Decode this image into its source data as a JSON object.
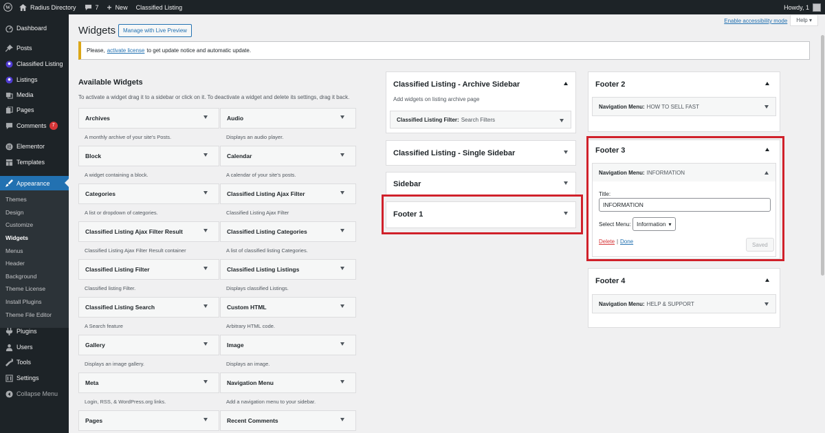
{
  "admin_bar": {
    "site_name": "Radius Directory",
    "comments_count": "7",
    "new_label": "New",
    "classified_label": "Classified Listing",
    "howdy": "Howdy, 1"
  },
  "sidebar": {
    "items": [
      {
        "label": "Dashboard",
        "icon": "dashboard-icon"
      },
      {
        "label": "Posts",
        "icon": "pin-icon"
      },
      {
        "label": "Classified Listing",
        "icon": "classified-icon"
      },
      {
        "label": "Listings",
        "icon": "listings-icon"
      },
      {
        "label": "Media",
        "icon": "media-icon"
      },
      {
        "label": "Pages",
        "icon": "pages-icon"
      },
      {
        "label": "Comments",
        "icon": "comments-icon",
        "badge": "7"
      },
      {
        "label": "Elementor",
        "icon": "elementor-icon"
      },
      {
        "label": "Templates",
        "icon": "templates-icon"
      },
      {
        "label": "Appearance",
        "icon": "appearance-icon"
      },
      {
        "label": "Plugins",
        "icon": "plugins-icon"
      },
      {
        "label": "Users",
        "icon": "users-icon"
      },
      {
        "label": "Tools",
        "icon": "tools-icon"
      },
      {
        "label": "Settings",
        "icon": "settings-icon"
      },
      {
        "label": "Collapse Menu",
        "icon": "collapse-icon"
      }
    ],
    "appearance_sub": [
      "Themes",
      "Design",
      "Customize",
      "Widgets",
      "Menus",
      "Header",
      "Background",
      "Theme License",
      "Install Plugins",
      "Theme File Editor"
    ]
  },
  "header": {
    "title": "Widgets",
    "preview_button": "Manage with Live Preview",
    "accessibility_link": "Enable accessibility mode",
    "help_label": "Help"
  },
  "notice": {
    "prefix": "Please,",
    "link": "activate license",
    "suffix": "to get update notice and automatic update."
  },
  "available": {
    "title": "Available Widgets",
    "description": "To activate a widget drag it to a sidebar or click on it. To deactivate a widget and delete its settings, drag it back.",
    "widgets": [
      {
        "name": "Archives",
        "desc": "A monthly archive of your site's Posts."
      },
      {
        "name": "Audio",
        "desc": "Displays an audio player."
      },
      {
        "name": "Block",
        "desc": "A widget containing a block."
      },
      {
        "name": "Calendar",
        "desc": "A calendar of your site's posts."
      },
      {
        "name": "Categories",
        "desc": "A list or dropdown of categories."
      },
      {
        "name": "Classified Listing Ajax Filter",
        "desc": "Classified Listing Ajax Filter"
      },
      {
        "name": "Classified Listing Ajax Filter Result",
        "desc": "Classified Listing Ajax Filter Result container"
      },
      {
        "name": "Classified Listing Categories",
        "desc": "A list of classified listing Categories."
      },
      {
        "name": "Classified Listing Filter",
        "desc": "Classified listing Filter."
      },
      {
        "name": "Classified Listing Listings",
        "desc": "Displays classified Listings."
      },
      {
        "name": "Classified Listing Search",
        "desc": "A Search feature"
      },
      {
        "name": "Custom HTML",
        "desc": "Arbitrary HTML code."
      },
      {
        "name": "Gallery",
        "desc": "Displays an image gallery."
      },
      {
        "name": "Image",
        "desc": "Displays an image."
      },
      {
        "name": "Meta",
        "desc": "Login, RSS, & WordPress.org links."
      },
      {
        "name": "Navigation Menu",
        "desc": "Add a navigation menu to your sidebar."
      },
      {
        "name": "Pages",
        "desc": ""
      },
      {
        "name": "Recent Comments",
        "desc": ""
      }
    ]
  },
  "sidebars": {
    "archive": {
      "title": "Classified Listing - Archive Sidebar",
      "desc": "Add widgets on listing archive page",
      "widget_name": "Classified Listing Filter:",
      "widget_value": "Search Filters"
    },
    "single": {
      "title": "Classified Listing - Single Sidebar"
    },
    "sidebar": {
      "title": "Sidebar"
    },
    "footer1": {
      "title": "Footer 1"
    },
    "footer2": {
      "title": "Footer 2",
      "widget_name": "Navigation Menu:",
      "widget_value": "HOW TO SELL FAST"
    },
    "footer3": {
      "title": "Footer 3",
      "widget_name": "Navigation Menu:",
      "widget_value": "INFORMATION",
      "title_label": "Title:",
      "title_value": "INFORMATION",
      "select_label": "Select Menu:",
      "select_value": "Information",
      "delete_label": "Delete",
      "separator": "|",
      "done_label": "Done",
      "saved_label": "Saved"
    },
    "footer4": {
      "title": "Footer 4",
      "widget_name": "Navigation Menu:",
      "widget_value": "HELP & SUPPORT"
    }
  }
}
